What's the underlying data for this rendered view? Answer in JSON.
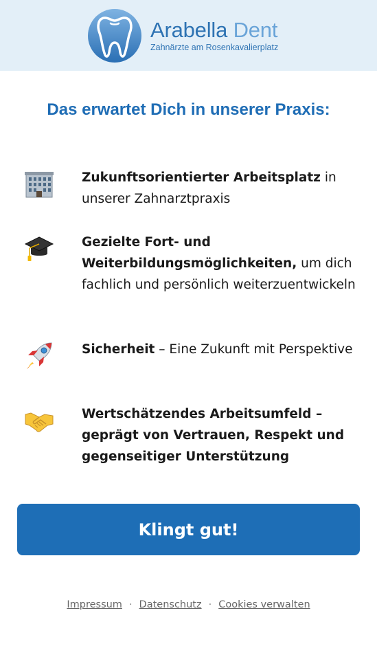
{
  "header": {
    "brand_part1": "Arabella",
    "brand_part2": "Dent",
    "tagline": "Zahnärzte am Rosenkavalierplatz"
  },
  "headline": "Das erwartet Dich in unserer Praxis:",
  "benefits": [
    {
      "icon": "office-building-icon",
      "bold": "Zukunftsorientierter Arbeitsplatz",
      "rest": " in unserer Zahnarztpraxis"
    },
    {
      "icon": "graduation-cap-icon",
      "bold": "Gezielte Fort- und Weiterbildungsmöglichkeiten,",
      "rest": " um dich fachlich und persönlich weiterzuentwickeln"
    },
    {
      "icon": "rocket-icon",
      "bold": "Sicherheit",
      "rest": " – Eine Zukunft mit Perspektive"
    },
    {
      "icon": "handshake-icon",
      "bold": "Wertschätzendes Arbeitsumfeld – geprägt von Vertrauen, Respekt und gegenseitiger Unterstützung",
      "rest": ""
    }
  ],
  "cta_label": "Klingt gut!",
  "footer": {
    "links": [
      "Impressum",
      "Datenschutz",
      "Cookies verwalten"
    ],
    "separator": "·"
  },
  "colors": {
    "header_bg": "#e3eff8",
    "brand_blue": "#1f6db5",
    "button_bg": "#1e6eb6"
  }
}
